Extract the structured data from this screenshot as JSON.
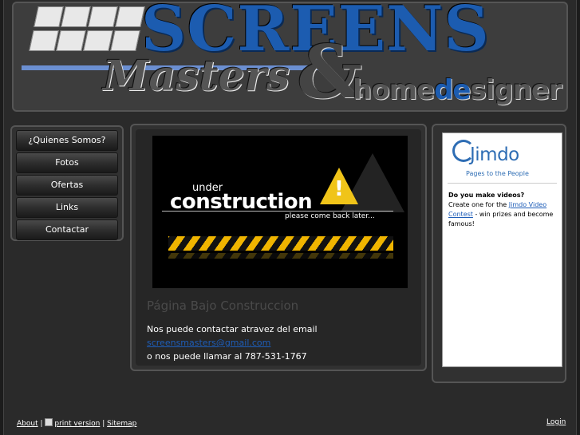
{
  "header": {
    "logo_main": "SCREENS",
    "logo_script": "Masters",
    "logo_amp": "&",
    "logo_tail_pre": "home",
    "logo_tail_accent": "de",
    "logo_tail_post": "signer"
  },
  "nav": {
    "items": [
      {
        "label": "¿Quienes Somos?"
      },
      {
        "label": "Fotos"
      },
      {
        "label": "Ofertas"
      },
      {
        "label": "Links"
      },
      {
        "label": "Contactar"
      }
    ]
  },
  "content": {
    "banner": {
      "under": "under",
      "construction": "construction",
      "come_back": "please come back later..."
    },
    "heading": "Página Bajo Construccion",
    "line1": "Nos puede contactar atravez del email",
    "email": "screensmasters@gmail.com",
    "line3": "o nos puede llamar al 787-531-1767"
  },
  "sidebar": {
    "jimdo_word": "Jimdo",
    "jimdo_tagline": "Pages to the People",
    "promo_title": "Do you make videos?",
    "promo_pre": "Create one for the ",
    "promo_link": "Jimdo Video Contest",
    "promo_post": " - win prizes and become famous!"
  },
  "footer": {
    "about": "About",
    "sep1": " | ",
    "print": "print version",
    "sep2": " | ",
    "sitemap": "Sitemap",
    "login": "Login"
  },
  "colors": {
    "accent": "#1c5cb0",
    "link": "#1e5db8",
    "background": "#2a2a2a"
  }
}
